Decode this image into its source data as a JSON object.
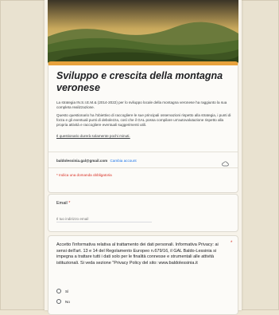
{
  "colors": {
    "accent": "#e8a23c",
    "required": "#d93025",
    "link": "#1a73e8",
    "page_background": "#ede5d2"
  },
  "header": {
    "image": "mountain-landscape-banner"
  },
  "form": {
    "title": "Sviluppo e crescita della montagna veronese",
    "description_1": "La strategia IN.S.I.E.M.& (2014-2022) per lo sviluppo locale della montagna veronese ha raggiunto la sua completa realizzazione.",
    "description_2": "Questo questionario ha l'obiettivo di raccogliere le sue principali osservazioni rispetto alla strategia, i punti di forza e gli eventuali punti di debolezza, così che il GAL possa compilare un'autovalutazione rispetto alla propria attività e raccogliere eventuali suggerimenti utili.",
    "description_3": "Il questionario durerà solamente pochi minuti.",
    "account_email": "baldolessinia.gal@gmail.com",
    "switch_account": "Cambia account",
    "required_note": "* Indica una domanda obbligatoria"
  },
  "email_question": {
    "label": "Email",
    "required_mark": "*",
    "placeholder": "Il tuo indirizzo email"
  },
  "privacy_question": {
    "text": "Accetto l'informativa relativa al trattamento dei dati personali. Informativa Privacy: ai sensi dell'art. 13 e 14 del Regolamento Europeo n.679/16, il GAL Baldo-Lessinia si impegna a trattare tutti i dati solo per le finalità connesse e strumentali alle attività istituzionali. Si veda sezione \"Privacy Policy del sito: www.baldolessinia.it",
    "required_mark": "*",
    "options": [
      "Sì",
      "No"
    ]
  },
  "icons": {
    "account_action": "cloud-icon"
  }
}
